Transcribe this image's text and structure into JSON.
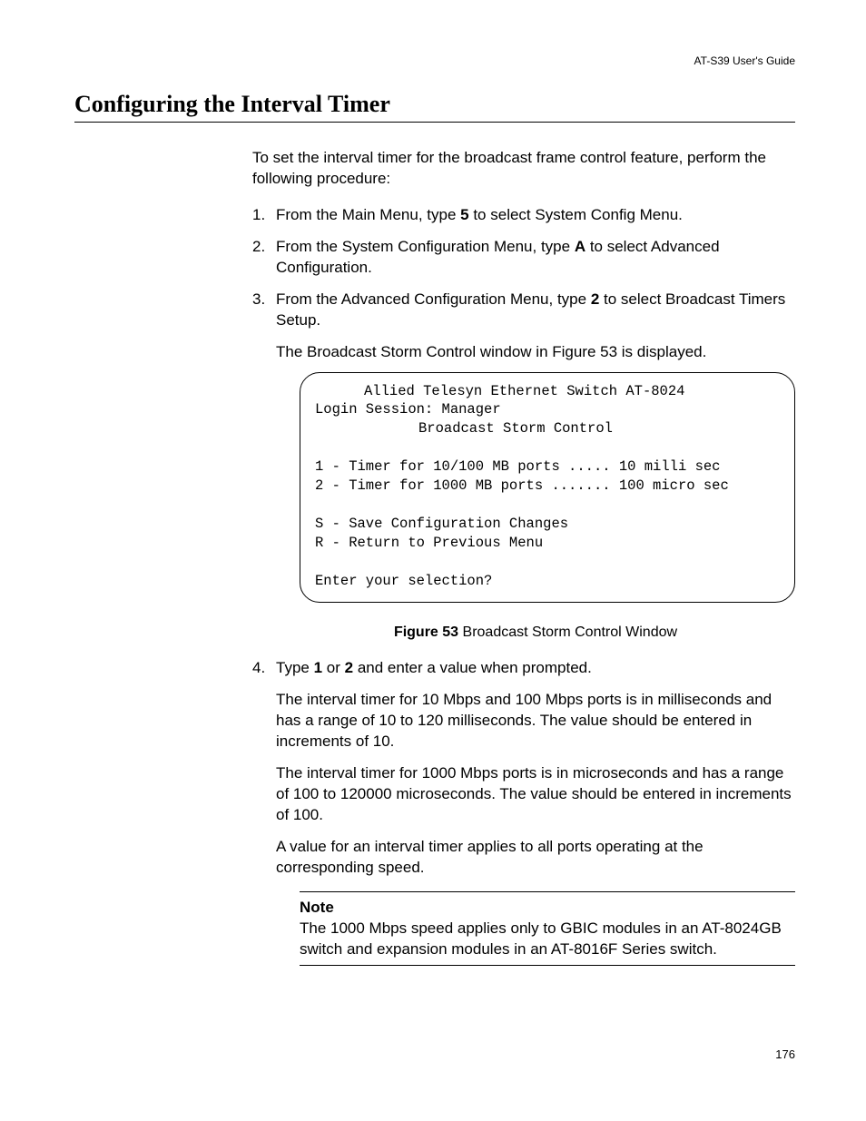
{
  "header": {
    "doc_title": "AT-S39 User's Guide"
  },
  "title": "Configuring the Interval Timer",
  "intro": "To set the interval timer for the broadcast frame control feature, perform the following procedure:",
  "steps": {
    "s1": {
      "num": "1.",
      "pre": "From the Main Menu, type ",
      "key": "5",
      "post": " to select System Config Menu."
    },
    "s2": {
      "num": "2.",
      "pre": "From the System Configuration Menu, type ",
      "key": "A",
      "post": " to select Advanced Configuration."
    },
    "s3": {
      "num": "3.",
      "pre": "From the Advanced Configuration Menu, type ",
      "key": "2",
      "post": " to select Broadcast Timers Setup."
    },
    "s3sub": "The Broadcast Storm Control window in Figure 53 is displayed.",
    "s4": {
      "num": "4.",
      "pre": "Type ",
      "k1": "1",
      "mid": " or ",
      "k2": "2",
      "post": " and enter a value when prompted."
    },
    "s4p1": "The interval timer for 10 Mbps and 100 Mbps ports is in milliseconds and has a range of 10 to 120 milliseconds. The value should be entered in increments of 10.",
    "s4p2": "The interval timer for 1000 Mbps ports is in microseconds and has a range of 100 to 120000 microseconds. The value should be entered in increments of 100.",
    "s4p3": "A value for an interval timer applies to all ports operating at the corresponding speed."
  },
  "terminal": {
    "l1": "Allied Telesyn Ethernet Switch AT-8024",
    "l2": "Login Session: Manager",
    "l3": "Broadcast Storm Control",
    "l4": "1 - Timer for 10/100 MB ports ..... 10 milli sec",
    "l5": "2 - Timer for 1000 MB ports ....... 100 micro sec",
    "l6": "S - Save Configuration Changes",
    "l7": "R - Return to Previous Menu",
    "l8": "Enter your selection?"
  },
  "figure": {
    "label": "Figure 53",
    "caption": "  Broadcast Storm Control Window"
  },
  "note": {
    "label": "Note",
    "text": "The 1000 Mbps speed applies only to GBIC modules in an AT-8024GB switch and expansion modules in an AT-8016F Series switch."
  },
  "page_number": "176"
}
